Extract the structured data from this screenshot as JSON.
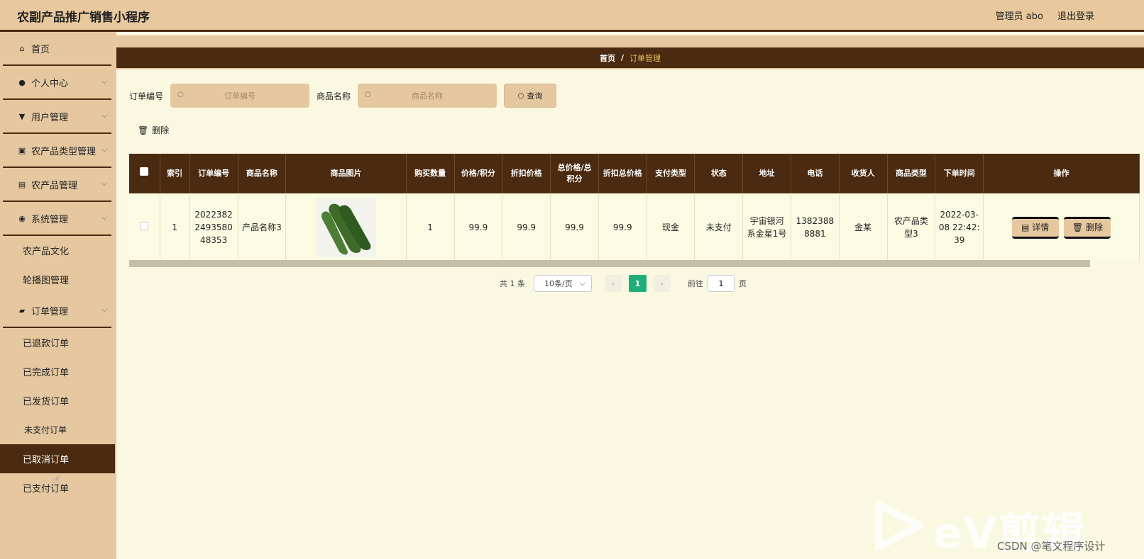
{
  "app": {
    "title": "农副产品推广销售小程序",
    "admin_label": "管理员 abo",
    "logout": "退出登录"
  },
  "sidebar": {
    "items": [
      {
        "label": "首页",
        "icon": "home-icon"
      },
      {
        "label": "个人中心",
        "icon": "user-icon"
      },
      {
        "label": "用户管理",
        "icon": "users-icon"
      },
      {
        "label": "农产品类型管理",
        "icon": "category-icon"
      },
      {
        "label": "农产品管理",
        "icon": "product-icon"
      },
      {
        "label": "系统管理",
        "icon": "system-icon"
      }
    ],
    "system_sub": [
      "农产品文化",
      "轮播图管理"
    ],
    "order_menu": {
      "label": "订单管理",
      "icon": "ticket-icon"
    },
    "order_sub": [
      "已退款订单",
      "已完成订单",
      "已发货订单",
      "未支付订单",
      "已取消订单",
      "已支付订单"
    ],
    "active": "已取消订单"
  },
  "breadcrumb": {
    "home": "首页",
    "sep": "/",
    "current": "订单管理"
  },
  "search": {
    "order_no_label": "订单编号",
    "order_no_placeholder": "订单编号",
    "product_label": "商品名称",
    "product_placeholder": "商品名称",
    "query_btn": "查询"
  },
  "toolbar": {
    "delete_label": "删除"
  },
  "table": {
    "headers": [
      "索引",
      "订单编号",
      "商品名称",
      "商品图片",
      "购买数量",
      "价格/积分",
      "折扣价格",
      "总价格/总积分",
      "折扣总价格",
      "支付类型",
      "状态",
      "地址",
      "电话",
      "收货人",
      "商品类型",
      "下单时间",
      "操作"
    ],
    "rows": [
      {
        "index": "1",
        "order_no": "202238224935804835 3",
        "order_no_display": "2022382 2493580 48353",
        "product": "产品名称3",
        "qty": "1",
        "price": "99.9",
        "discount_price": "99.9",
        "total": "99.9",
        "discount_total": "99.9",
        "pay_type": "现金",
        "status": "未支付",
        "address": "宇宙银河系金星1号",
        "phone": "13823888881",
        "receiver": "金某",
        "category": "农产品类型3",
        "time": "2022-03-08 22:42:39",
        "detail_btn": "详情",
        "delete_btn": "删除"
      }
    ]
  },
  "pager": {
    "total": "共 1 条",
    "page_size": "10条/页",
    "current": "1",
    "goto": "前往",
    "goto_value": "1",
    "page_unit": "页"
  },
  "watermark": {
    "brand": "eV剪辑",
    "csdn": "CSDN @笔文程序设计"
  }
}
